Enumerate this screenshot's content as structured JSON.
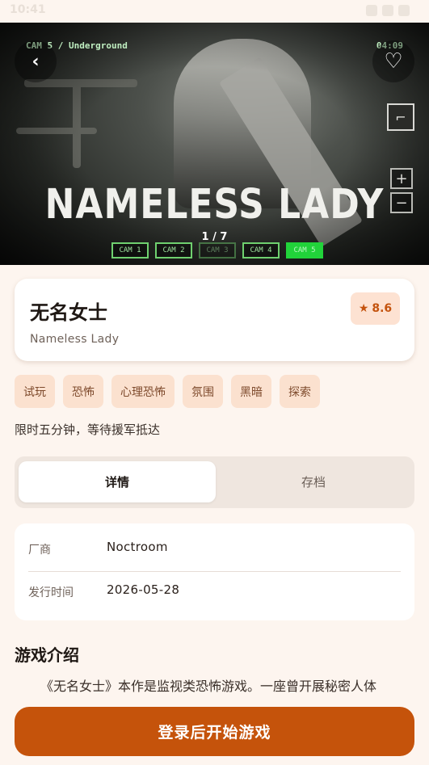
{
  "status_bar": {
    "time": "10:41"
  },
  "hero": {
    "cam_label": "CAM 5 / Underground",
    "cam_time": "04:09",
    "title": "NAMELESS LADY",
    "pager": "1 / 7",
    "cam_buttons": [
      "CAM 1",
      "CAM 2",
      "CAM 3",
      "CAM 4",
      "CAM 5"
    ],
    "zoom_in": "+",
    "zoom_out": "−",
    "back_glyph": "‹",
    "fav_glyph": "♡"
  },
  "game": {
    "title_zh": "无名女士",
    "title_en": "Nameless Lady",
    "rating_star": "★",
    "rating": "8.6",
    "tags": [
      "试玩",
      "恐怖",
      "心理恐怖",
      "氛围",
      "黑暗",
      "探索"
    ],
    "tagline": "限时五分钟，等待援军抵达"
  },
  "tabs": {
    "details": "详情",
    "saves": "存档"
  },
  "info": {
    "vendor_label": "厂商",
    "vendor": "Noctroom",
    "release_label": "发行时间",
    "release": "2026-05-28"
  },
  "intro": {
    "heading": "游戏介绍",
    "text": "《无名女士》本作是监视类恐怖游戏。一座曾开展秘密人体"
  },
  "cta": {
    "label": "登录后开始游戏"
  },
  "colors": {
    "accent": "#c5530b",
    "tag_bg": "#fbe1cf",
    "page_bg": "#fdf5ef"
  }
}
